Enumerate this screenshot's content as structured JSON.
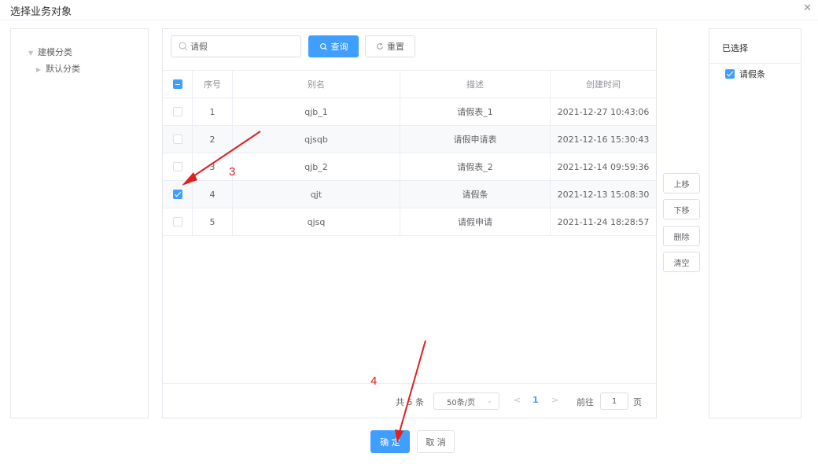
{
  "dialog": {
    "title": "选择业务对象"
  },
  "tree": {
    "root": "建模分类",
    "child": "默认分类"
  },
  "search": {
    "value": "请假",
    "placeholder": "请假"
  },
  "toolbar": {
    "query_label": "查询",
    "reset_label": "重置"
  },
  "table": {
    "headers": [
      "序号",
      "别名",
      "描述",
      "创建时间"
    ],
    "rows": [
      {
        "no": "1",
        "alias": "qjb_1",
        "desc": "请假表_1",
        "time": "2021-12-27 10:43:06",
        "checked": false
      },
      {
        "no": "2",
        "alias": "qjsqb",
        "desc": "请假申请表",
        "time": "2021-12-16 15:30:43",
        "checked": false
      },
      {
        "no": "3",
        "alias": "qjb_2",
        "desc": "请假表_2",
        "time": "2021-12-14 09:59:36",
        "checked": false
      },
      {
        "no": "4",
        "alias": "qjt",
        "desc": "请假条",
        "time": "2021-12-13 15:08:30",
        "checked": true
      },
      {
        "no": "5",
        "alias": "qjsq",
        "desc": "请假申请",
        "time": "2021-11-24 18:28:57",
        "checked": false
      }
    ]
  },
  "pagination": {
    "total_text": "共 5 条",
    "page_size": "50条/页",
    "prev": "<",
    "current_page": "1",
    "next": ">",
    "goto_label": "前往",
    "goto_value": "1",
    "page_unit": "页"
  },
  "actions": {
    "move_up": "上移",
    "move_down": "下移",
    "delete": "删除",
    "clear": "清空"
  },
  "selected": {
    "title": "已选择",
    "items": [
      "请假条"
    ]
  },
  "footer": {
    "ok_label": "确 定",
    "cancel_label": "取 消"
  },
  "annotations": {
    "step3": "3",
    "step4": "4"
  },
  "colors": {
    "primary": "#409eff",
    "annotation": "#e02020"
  }
}
